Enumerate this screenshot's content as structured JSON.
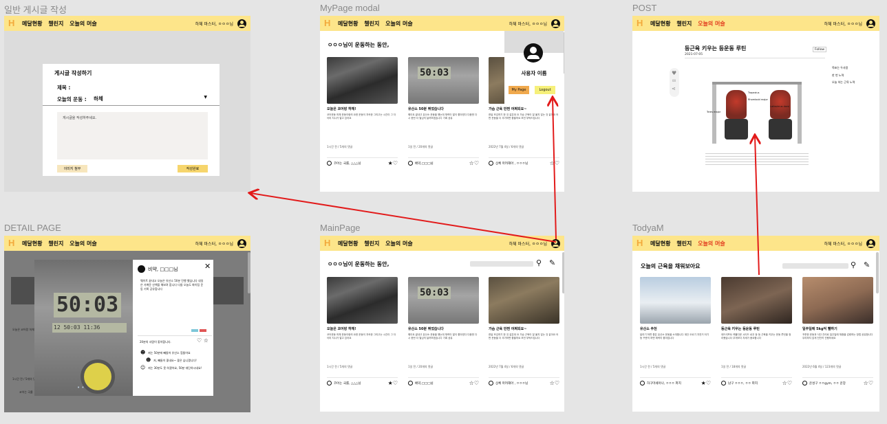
{
  "frames": {
    "write": {
      "title": "일반 게시글 작성"
    },
    "mypage": {
      "title": "MyPage modal"
    },
    "post": {
      "title": "POST"
    },
    "detail": {
      "title": "DETAIL PAGE"
    },
    "main": {
      "title": "MainPage"
    },
    "today": {
      "title": "TodyaM"
    }
  },
  "header": {
    "nav": [
      "메달현황",
      "챌린지",
      "오늘의 머슬"
    ],
    "user": "하체 마스터, ㅇㅇㅇ님"
  },
  "write": {
    "form_title": "게시글 작성하기",
    "subject_label": "제목 :",
    "exercise_label": "오늘의 운동 :",
    "exercise_value": "하체",
    "textarea_placeholder": "게시글을 작성하주세요.",
    "attach": "이미지 첨부",
    "submit": "작성완료"
  },
  "main": {
    "heading": "ㅇㅇㅇ님이 운동하는 동안,"
  },
  "cards": [
    {
      "title": "오늘은 코어랑 하체!",
      "body": "코어운동 하체 운동이랑의 요한 운동이 지속한 그리고는 시간이 그 더 이미 지나가 알고 있어요",
      "meta": "1시간 전 / 5개의 댓글",
      "who": "코어는 국룰, △△△님",
      "acts": "★♡"
    },
    {
      "title": "유산소 50분 뛰었습니다",
      "body": "웨이트 끝내고 유산소 운동을 했는데 체력이 많이 좋아졌다 다음엔 다시 한번 더 열심히 달려보겠습니다 기록 공유",
      "meta": "1일 전 / 20개의 댓글",
      "who": "베약,□□□님",
      "acts": "☆♡"
    },
    {
      "title": "가슴 근육 만쩐 어쩌되요~",
      "body": "한달 조깅하기 한 것 같은데 요 가슴 근육이 잘 붙지 않는 것 같아요 어떤 운동을 더 추가하면 좋을까요 조언 부탁드립니다",
      "meta": "2022년 7월 4일 / 6개의 댓글",
      "who": "상체 마려해아 , ㅇㅇㅇ님",
      "acts": "☆♡"
    }
  ],
  "today_cards": [
    {
      "title": "유산소 추천",
      "body": "달리기 하면 좋은 유산소 운동을 소개합니다 계단 오르기 자전거 타기 등 꾸준히 하면 체력이 좋아집니다",
      "meta": "1시간 전 / 5개의 댓글",
      "who": "하구마세아나, ㅇㅇㅇ 파지",
      "acts": "★♡"
    },
    {
      "title": "등근육 키우는 등운동 루틴",
      "body": "데드리프트 렛풀다운 시티드 로우 등 등 근육을 키우는 운동 루틴을 정리했습니다 무게보다 자세가 중요합니다",
      "meta": "1일 전 / 18개의 댓글",
      "who": "남구 ㅇㅇㅇ, ㅇㅇ 파지",
      "acts": "☆♡"
    },
    {
      "title": "일주일에 5kg씩 뺄하기",
      "body": "꾸준한 운동과 식단 관리로 일주일에 체중을 감량하는 방법 공유합니다 무리하지 않게 천천히 진행하세요",
      "meta": "2022년 6월 4일 / 123개의 댓글",
      "who": "운성구 ㅇㅇgym, ㅇㅇ 운장",
      "acts": "☆♡"
    }
  ],
  "today": {
    "heading": "오늘의 근육을 채워보아요"
  },
  "mypage": {
    "username": "사용자 이름",
    "btn_mypage": "My Page",
    "btn_logout": "Logout"
  },
  "post": {
    "title": "등근육 키우는 등운동 루틴",
    "date": "2021-07-05",
    "follow": "Follow",
    "toc": [
      "목표는 두사람",
      "한 번 노력",
      "오늘 하는 근육 노력"
    ],
    "likes": "00",
    "figure_labels": [
      "Trapezius",
      "Rhomboid major",
      "Teres major",
      "Latissimus dorsi"
    ]
  },
  "detail": {
    "author": "비약, □□□님",
    "text": "웨이트 끝내고 오늘은 유산소 50분 진행 했습니다 내일은 가벼운 산책을 해보려 합니다 다들 오늘도 화이팅 운동 기록 공유합니다",
    "lcd": "50:03",
    "lcd2": "12 50:03 11:36",
    "likes_text": "20분의 사람이 좋아합니다.",
    "comments": [
      "저는 50분에 빼들어 유산소 힘들어요",
      "저, 빼들이 좋네요~ 좋은 습니겠니다!",
      "저는 30분도 못 하겠어요, 50분 대단하시네요!"
    ],
    "bg_card_title": "오늘은 코어랑 하체",
    "bg_meta": "1시간 전 / 5개의 댓글",
    "bg_who": "코어는 국룰"
  },
  "colors": {
    "header": "#fde58a",
    "accent": "#e23c1f",
    "button": "#f6d56c",
    "arrow": "#e21a1a"
  }
}
